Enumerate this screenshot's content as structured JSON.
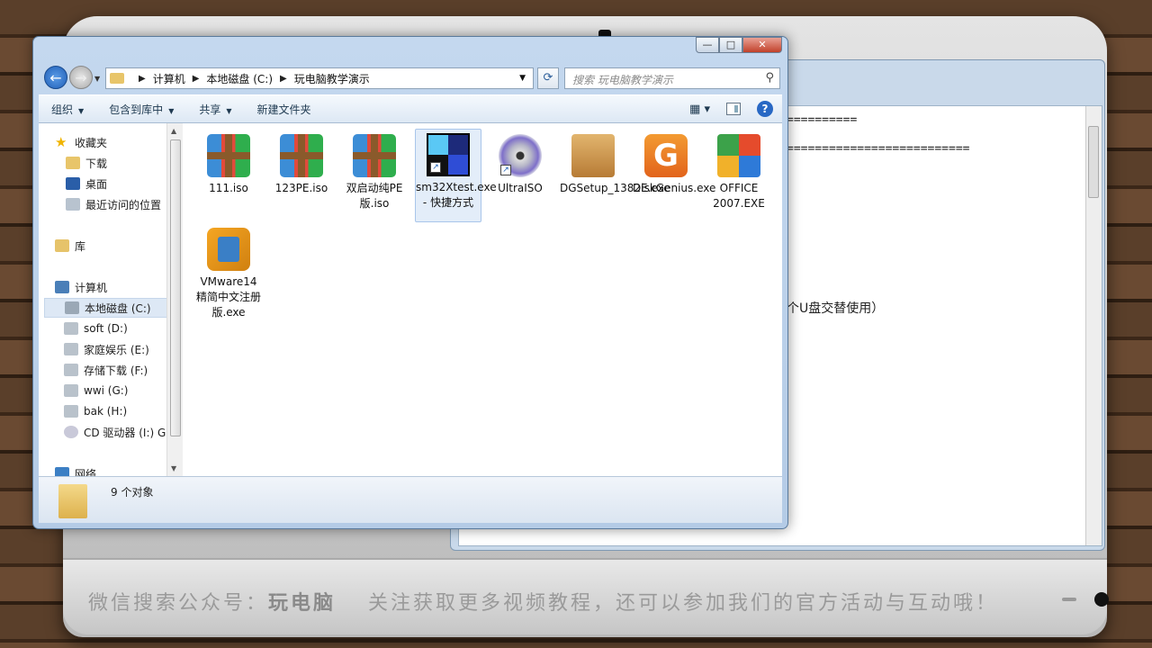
{
  "explorer": {
    "breadcrumb": [
      "计算机",
      "本地磁盘 (C:)",
      "玩电脑教学演示"
    ],
    "search_placeholder": "搜索 玩电脑教学演示",
    "toolbar": {
      "organize": "组织",
      "include": "包含到库中",
      "share": "共享",
      "new_folder": "新建文件夹"
    },
    "window_controls": {
      "minimize": "—",
      "maximize": "□",
      "close": "✕"
    },
    "sidebar": {
      "favorites": "收藏夹",
      "fav_items": [
        "下载",
        "桌面",
        "最近访问的位置"
      ],
      "library": "库",
      "computer": "计算机",
      "drives": [
        "本地磁盘 (C:)",
        "soft (D:)",
        "家庭娱乐 (E:)",
        "存储下载 (F:)",
        "wwi (G:)",
        "bak (H:)",
        "CD 驱动器 (I:) G"
      ],
      "network": "网络"
    },
    "files": [
      {
        "name": "111.iso",
        "icon": "winrar-archive-icon"
      },
      {
        "name": "123PE.iso",
        "icon": "winrar-archive-icon"
      },
      {
        "name": "双启动纯PE版.iso",
        "icon": "winrar-archive-icon"
      },
      {
        "name": "sm32Xtest.exe - 快捷方式",
        "icon": "sm32-shortcut-icon"
      },
      {
        "name": "UltraISO",
        "icon": "disc-icon"
      },
      {
        "name": "DGSetup_1382E.exe",
        "icon": "setup-box-icon"
      },
      {
        "name": "DiskGenius.exe",
        "icon": "diskgenius-icon"
      },
      {
        "name": "OFFICE 2007.EXE",
        "icon": "office-icon"
      },
      {
        "name": "VMware14精简中文注册版.exe",
        "icon": "vmware-icon"
      }
    ],
    "status": "9 个对象"
  },
  "background_window": {
    "lines": [
      "==========",
      "==========================",
      "个U盘交替使用）"
    ]
  },
  "banner": {
    "prefix": "微信搜索公众号：",
    "brand": "玩电脑",
    "suffix": "关注获取更多视频教程，还可以参加我们的官方活动与互动哦！"
  },
  "colors": {
    "accent": "#2868c4",
    "close_red": "#c1412a",
    "selection": "#e3edf9"
  }
}
